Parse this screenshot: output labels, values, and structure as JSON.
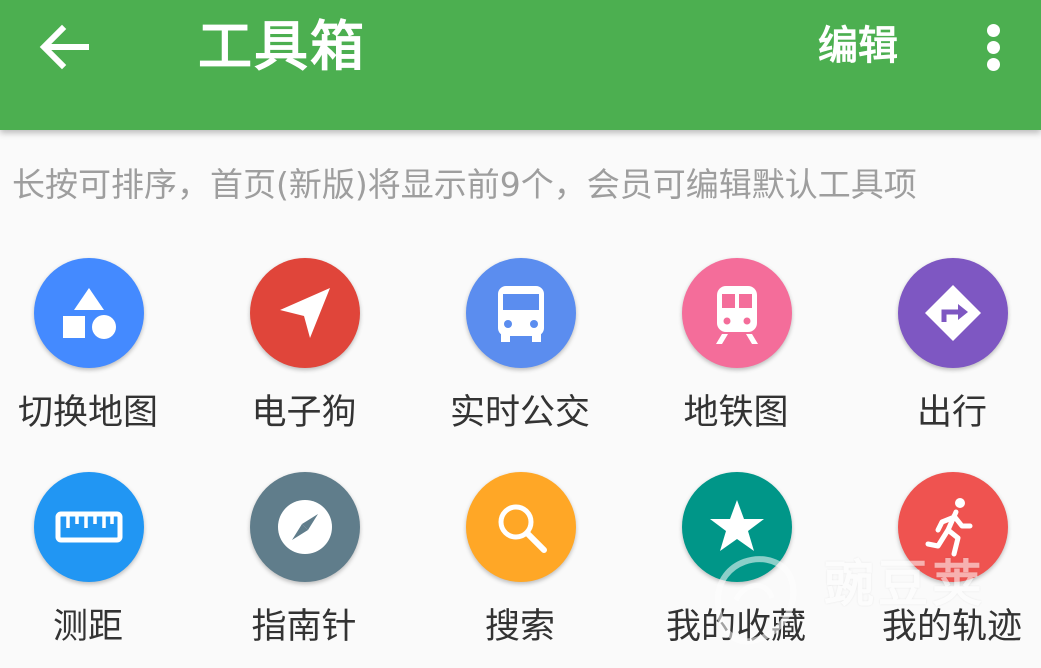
{
  "appbar": {
    "title": "工具箱",
    "edit_label": "编辑",
    "back_icon": "arrow-back-icon",
    "more_icon": "more-vert-icon",
    "background": "#4caf50"
  },
  "hint": "长按可排序，首页(新版)将显示前9个，会员可编辑默认工具项",
  "tools": [
    {
      "label": "切换地图",
      "icon": "layers-shapes-icon",
      "color": "#448aff"
    },
    {
      "label": "电子狗",
      "icon": "navigation-arrow-icon",
      "color": "#e0453a"
    },
    {
      "label": "实时公交",
      "icon": "bus-icon",
      "color": "#5b8def"
    },
    {
      "label": "地铁图",
      "icon": "subway-icon",
      "color": "#f46d9a"
    },
    {
      "label": "出行",
      "icon": "directions-icon",
      "color": "#7e57c2"
    },
    {
      "label": "测距",
      "icon": "ruler-icon",
      "color": "#2196f3"
    },
    {
      "label": "指南针",
      "icon": "compass-icon",
      "color": "#607d8b"
    },
    {
      "label": "搜索",
      "icon": "search-icon",
      "color": "#ffa726"
    },
    {
      "label": "我的收藏",
      "icon": "star-icon",
      "color": "#009688"
    },
    {
      "label": "我的轨迹",
      "icon": "running-person-icon",
      "color": "#ef5350"
    }
  ],
  "watermark": {
    "text": "豌豆荚",
    "icon": "wandoujia-logo-icon"
  }
}
